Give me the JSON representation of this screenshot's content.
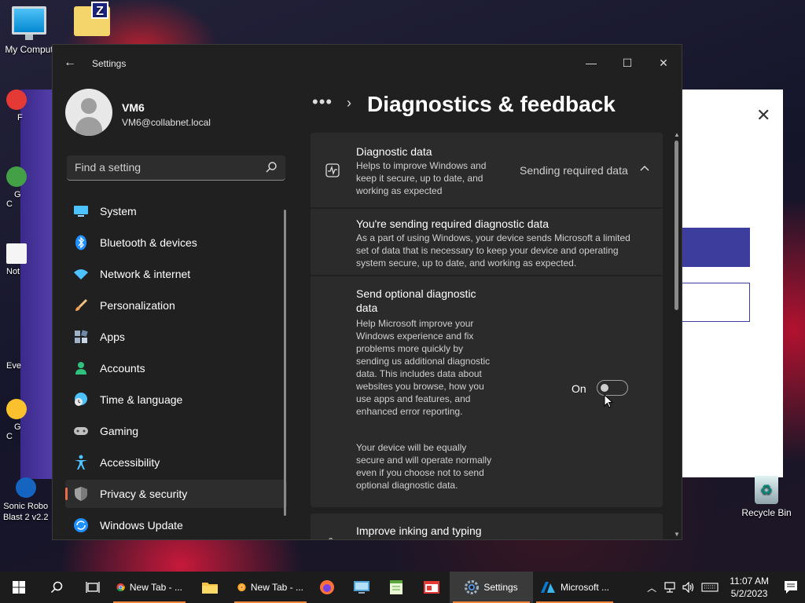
{
  "desktop": {
    "icons": [
      {
        "label": "My Comput"
      },
      {
        "label": ""
      }
    ],
    "side_labels": [
      "F",
      "G\nC",
      "Not",
      "Eve",
      "G\nC",
      "Sonic Robo\nBlast 2 v2.2"
    ],
    "recycle_label": "Recycle Bin"
  },
  "window": {
    "title": "Settings",
    "minimize": "—",
    "maximize": "☐",
    "close": "✕"
  },
  "profile": {
    "name": "VM6",
    "email": "VM6@collabnet.local"
  },
  "search": {
    "placeholder": "Find a setting"
  },
  "nav": {
    "items": [
      {
        "label": "System",
        "icon": "monitor-icon",
        "color": "#4cc2ff"
      },
      {
        "label": "Bluetooth & devices",
        "icon": "bluetooth-icon",
        "color": "#1e90ff"
      },
      {
        "label": "Network & internet",
        "icon": "wifi-icon",
        "color": "#4cc2ff"
      },
      {
        "label": "Personalization",
        "icon": "brush-icon",
        "color": "#f0a050"
      },
      {
        "label": "Apps",
        "icon": "apps-icon",
        "color": "#9fb3c8"
      },
      {
        "label": "Accounts",
        "icon": "person-icon",
        "color": "#2ec27e"
      },
      {
        "label": "Time & language",
        "icon": "clock-globe-icon",
        "color": "#4cc2ff"
      },
      {
        "label": "Gaming",
        "icon": "gamepad-icon",
        "color": "#c0c0c0"
      },
      {
        "label": "Accessibility",
        "icon": "accessibility-icon",
        "color": "#4cc2ff"
      },
      {
        "label": "Privacy & security",
        "icon": "shield-icon",
        "color": "#a0a0a0",
        "active": true
      },
      {
        "label": "Windows Update",
        "icon": "update-icon",
        "color": "#4cc2ff"
      }
    ]
  },
  "breadcrumb": {
    "overflow": "•••",
    "separator": "›",
    "title": "Diagnostics & feedback"
  },
  "diagnostic": {
    "title": "Diagnostic data",
    "description": "Helps to improve Windows and keep it secure, up to date, and working as expected",
    "status": "Sending required data",
    "required_title": "You're sending required diagnostic data",
    "required_desc": "As a part of using Windows, your device sends Microsoft a limited set of data that is necessary to keep your device and operating system secure, up to date, and working as expected.",
    "optional_title": "Send optional diagnostic data",
    "optional_desc": "Help Microsoft improve your Windows experience and fix problems more quickly by sending us additional diagnostic data. This includes data about websites you browse, how you use apps and features, and enhanced error reporting.",
    "optional_desc2": "Your device will be equally secure and will operate normally even if you choose not to send optional diagnostic data.",
    "toggle_label": "On",
    "toggle_on": true
  },
  "inking": {
    "title": "Improve inking and typing"
  },
  "taskbar": {
    "apps": [
      {
        "label": "New Tab - ...",
        "icon": "chrome-icon",
        "running": true
      },
      {
        "label": "",
        "icon": "file-explorer-icon",
        "running": false
      },
      {
        "label": "New Tab - ...",
        "icon": "chrome-canary-icon",
        "running": true
      },
      {
        "label": "",
        "icon": "firefox-icon",
        "running": false
      },
      {
        "label": "",
        "icon": "remote-desktop-icon",
        "running": false
      },
      {
        "label": "",
        "icon": "notepad-icon",
        "running": false
      },
      {
        "label": "",
        "icon": "media-icon",
        "running": false
      },
      {
        "label": "Settings",
        "icon": "settings-gear-icon",
        "running": true,
        "active": true
      },
      {
        "label": "Microsoft ...",
        "icon": "azure-icon",
        "running": true
      }
    ],
    "time": "11:07 AM",
    "date": "5/2/2023"
  },
  "colors": {
    "accent": "#e86c4a",
    "window_bg": "#202020",
    "card_bg": "#2b2b2b"
  }
}
